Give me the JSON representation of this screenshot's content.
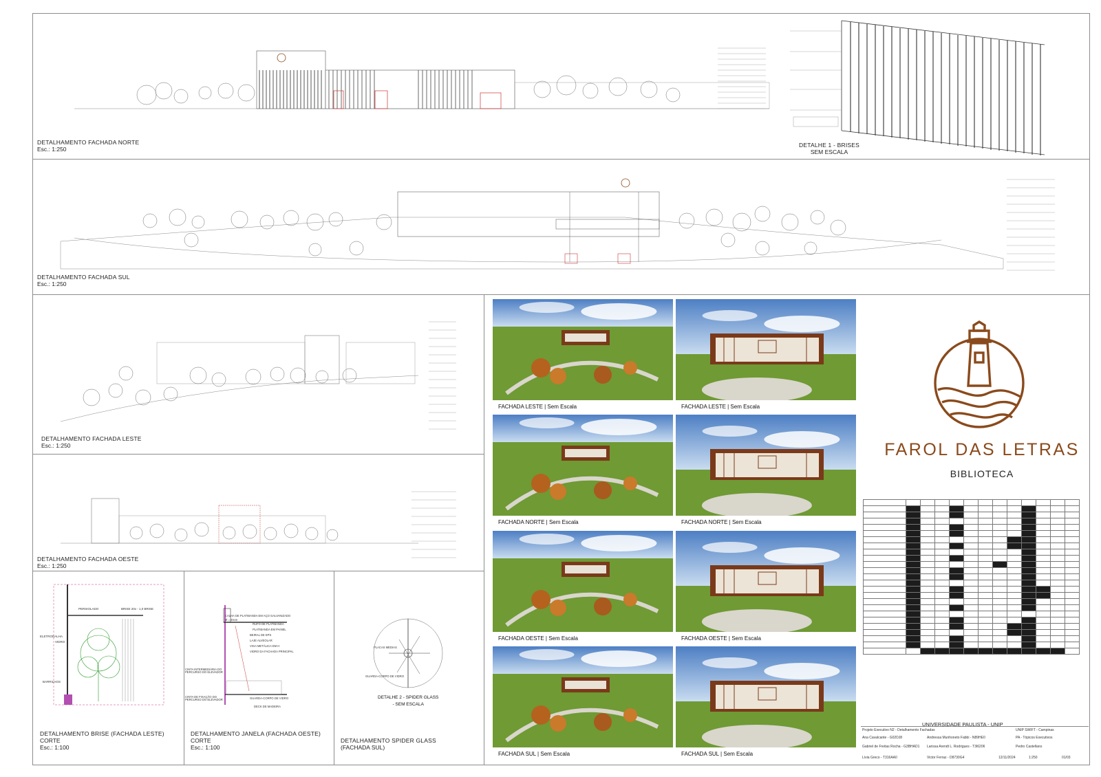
{
  "sheet": {
    "north_title": "DETALHAMENTO FACHADA NORTE",
    "north_scale": "Esc.: 1:250",
    "brise_title": "DETALHE 1 - BRISES",
    "brise_scale": "SEM ESCALA",
    "south_title": "DETALHAMENTO FACHADA SUL",
    "south_scale": "Esc.: 1:250",
    "east_title": "DETALHAMENTO FACHADA LESTE",
    "east_scale": "Esc.: 1:250",
    "west_title": "DETALHAMENTO FACHADA OESTE",
    "west_scale": "Esc.: 1:250",
    "brise_cut_title": "DETALHAMENTO BRISE (FACHADA LESTE)",
    "brise_cut_sub": "CORTE",
    "brise_cut_scale": "Esc.: 1:100",
    "window_title": "DETALHAMENTO JANELA (FACHADA OESTE)",
    "window_sub": "CORTE",
    "window_scale": "Esc.: 1:100",
    "spider_title": "DETALHAMENTO SPIDER GLASS",
    "spider_sub": "(FACHADA SUL)",
    "spider_detail": "DETALHE 2 - SPIDER GLASS",
    "spider_detail_scale": "- SEM ESCALA"
  },
  "labels": {
    "brise_cut": [
      "PERSIOLADO",
      "BRISE 20x - 1,0 BRISE",
      "ELETRODALHA",
      "VIDRO",
      "BARRILHOS"
    ],
    "window_cut": [
      "CALHA DE PLATIBANDA EM AÇO GALVANIZADO",
      "Ø = 20cm",
      "RUFO DE PLATIBANDA",
      "PLATIBANDA EM PAINEL",
      "BEIRAL DE EPS",
      "LAJE ALVEOLAR",
      "VIGA METÁLICA EM H",
      "VIDRO DA FACHADA PRINCIPAL",
      "CINTA INTERMEDIÁRIA DO PERCURSO DO ELEVADOR",
      "CINTA DE FIXAÇÃO DO PERCURSO DO ELEVADOR",
      "GUARDA-CORPO DE VIDRO",
      "DECK DE MADEIRA"
    ],
    "spider": [
      "PLACAS MEDIAS",
      "GUARDA-CORPO DE VIDRO"
    ]
  },
  "renders": [
    {
      "caption": "FACHADA LESTE | Sem Escala"
    },
    {
      "caption": "FACHADA LESTE | Sem Escala"
    },
    {
      "caption": "FACHADA NORTE | Sem Escala"
    },
    {
      "caption": "FACHADA NORTE | Sem Escala"
    },
    {
      "caption": "FACHADA OESTE | Sem Escala"
    },
    {
      "caption": "FACHADA OESTE | Sem Escala"
    },
    {
      "caption": "FACHADA SUL | Sem Escala"
    },
    {
      "caption": "FACHADA SUL | Sem Escala"
    }
  ],
  "brand": {
    "name": "FAROL DAS LETRAS",
    "sub": "BIBLIOTECA",
    "color": "#8a4a1c",
    "logo_icon": "lighthouse-icon"
  },
  "stamp": {
    "university": "UNIVERSIDADE PAULISTA - UNIP",
    "project_label": "Projeto Executivo N2 - Detalhamento Fachadas",
    "campus": "UNIP SWIFT - Campinas",
    "students": [
      "Ana Cavalcante - G02DJ8",
      "Andressa Munhoneto Fabbi - N89HE0",
      "Gabriel de Freitas Rocha - G3BHAD1",
      "Larissa Arendt L. Rodrigues - T3I6206",
      "Lívia Greco - T316AA0",
      "Victor Ferraz - D8730G4"
    ],
    "subject": "PA - Tópicos Executivos",
    "professor": "Pedro Castellano",
    "date": "12/11/2024",
    "scale": "1:250",
    "sheet_no": "01/03"
  }
}
